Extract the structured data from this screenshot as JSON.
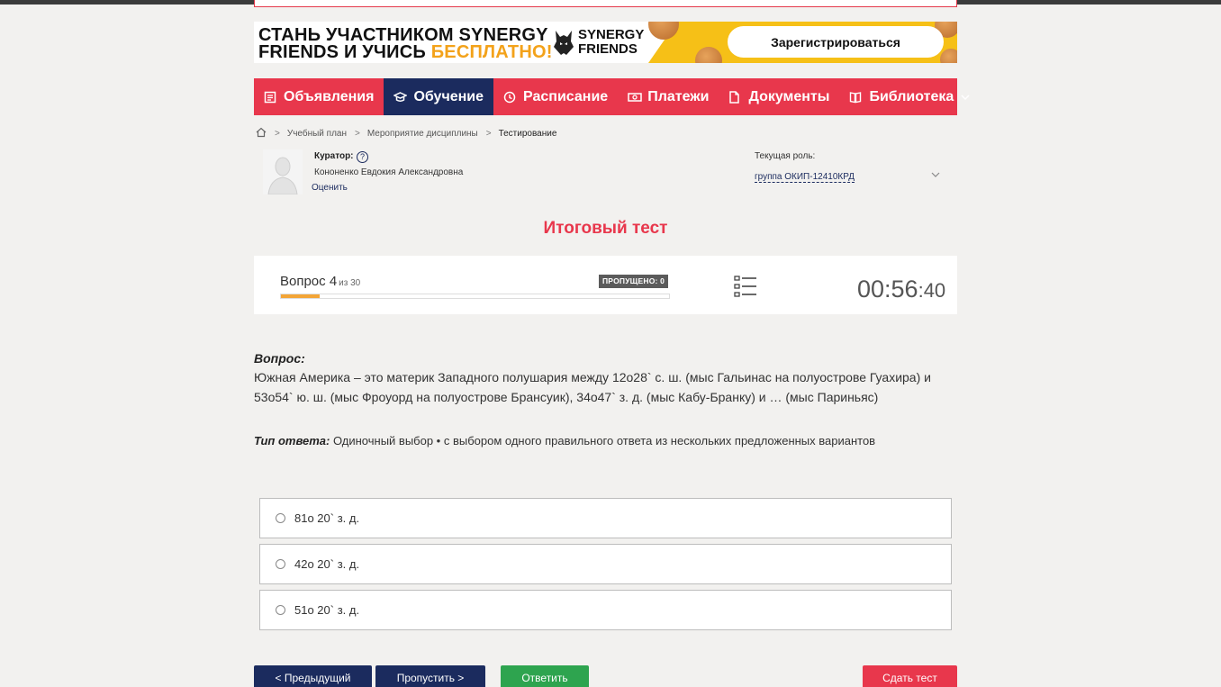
{
  "banner": {
    "line1": "СТАНЬ УЧАСТНИКОМ SYNERGY",
    "line2_prefix": "FRIENDS И УЧИСЬ ",
    "line2_highlight": "БЕСПЛАТНО!",
    "logo_line1": "SYNERGY",
    "logo_line2": "FRIENDS",
    "register_label": "Зарегистрироваться"
  },
  "nav": {
    "items": [
      {
        "label": "Объявления",
        "icon": "announcement-icon"
      },
      {
        "label": "Обучение",
        "icon": "graduation-cap-icon"
      },
      {
        "label": "Расписание",
        "icon": "clock-icon"
      },
      {
        "label": "Платежи",
        "icon": "money-icon"
      },
      {
        "label": "Документы",
        "icon": "document-icon"
      },
      {
        "label": "Библиотека",
        "icon": "book-icon"
      }
    ]
  },
  "breadcrumb": {
    "items": [
      "Учебный план",
      "Мероприятие дисциплины",
      "Тестирование"
    ]
  },
  "curator": {
    "label": "Куратор:",
    "help": "?",
    "name": "Кононенко Евдокия Александровна",
    "rate_label": "Оценить"
  },
  "role": {
    "label": "Текущая роль:",
    "value": "группа ОКИП-12410КРД"
  },
  "test": {
    "title": "Итоговый тест",
    "question_label": "Вопрос 4",
    "question_of": "из 30",
    "skipped_label": "ПРОПУЩЕНО: 0",
    "progress": 0.1,
    "timer_main": "00:56",
    "timer_sec": ":40"
  },
  "question": {
    "label": "Вопрос:",
    "text": "Южная Америка – это материк Западного полушария между 12о28` с. ш. (мыс Гальинас на полуострове Гуахира) и 53о54` ю. ш. (мыс Фроуорд на полуострове Брансуик), 34о47` з. д. (мыс Кабу-Бранку) и … (мыс Париньяс)",
    "answer_type_label": "Тип ответа:",
    "answer_type_value": " Одиночный выбор • с выбором одного правильного ответа из нескольких предложенных вариантов"
  },
  "options": [
    "81о 20` з. д.",
    "42о 20` з. д.",
    "51о 20` з. д."
  ],
  "buttons": {
    "prev": "< Предыдущий",
    "skip": "Пропустить >",
    "answer": "Ответить",
    "finish": "Сдать тест"
  },
  "colors": {
    "brand_red": "#e8374c",
    "navy": "#1b2b5e",
    "progress_orange": "#f3a537",
    "banner_yellow": "#f6c017"
  }
}
